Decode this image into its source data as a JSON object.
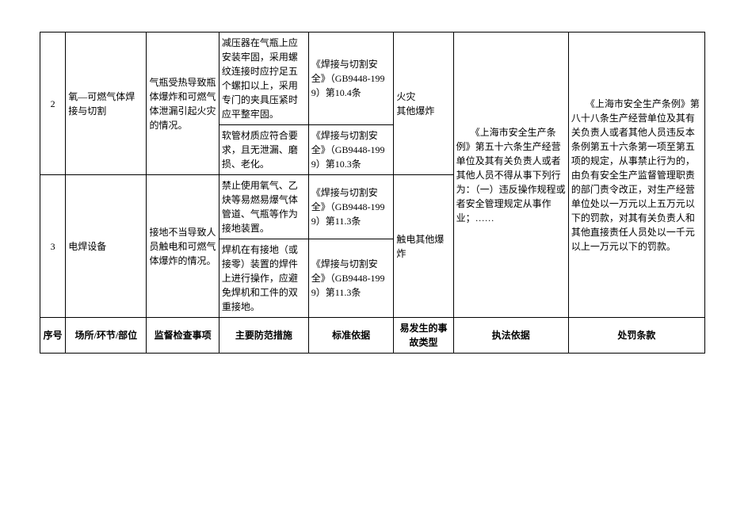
{
  "rows": [
    {
      "num": "2",
      "place": "氧—可燃气体焊接与切割",
      "inspection": "气瓶受热导致瓶体爆炸和可燃气体泄漏引起火灾的情况。",
      "measure_a": "减压器在气瓶上应安装牢固，采用螺纹连接时应拧足五个螺扣以上，采用专门的夹具压紧时应平整牢固。",
      "std_a": "《焊接与切割安全》（GB9448-1999）第10.4条",
      "measure_b": "软管材质应符合要求，且无泄漏、磨损、老化。",
      "std_b": "《焊接与切割安全》（GB9448-1999）第10.3条",
      "accident": "火灾\n其他爆炸"
    },
    {
      "num": "3",
      "place": "电焊设备",
      "inspection": "接地不当导致人员触电和可燃气体爆炸的情况。",
      "measure_a": "禁止使用氧气、乙炔等易燃易爆气体管道、气瓶等作为接地装置。",
      "std_a": "《焊接与切割安全》（GB9448-1999）第11.3条",
      "measure_b": "焊机在有接地（或接零）装置的焊件上进行操作，应避免焊机和工件的双重接地。",
      "std_b": "《焊接与切割安全》（GB9448-1999）第11.3条",
      "accident": "触电其他爆炸"
    }
  ],
  "law_basis": "　　《上海市安全生产条例》第五十六条生产经营单位及其有关负责人或者其他人员不得从事下列行为：（一）违反操作规程或者安全管理规定从事作业；……",
  "penalty": "　　《上海市安全生产条例》第八十八条生产经营单位及其有关负责人或者其他人员违反本条例第五十六条第一项至第五项的规定，从事禁止行为的，由负有安全生产监督管理职责的部门责令改正，对生产经营单位处以一万元以上五万元以下的罚款，对其有关负责人和其他直接责任人员处以一千元以上一万元以下的罚款。",
  "headers": {
    "num": "序号",
    "place": "场所/环节/部位",
    "inspection": "监督检查事项",
    "measure": "主要防范措施",
    "standard": "标准依据",
    "accident": "易发生的事故类型",
    "law": "执法依据",
    "penalty": "处罚条款"
  }
}
